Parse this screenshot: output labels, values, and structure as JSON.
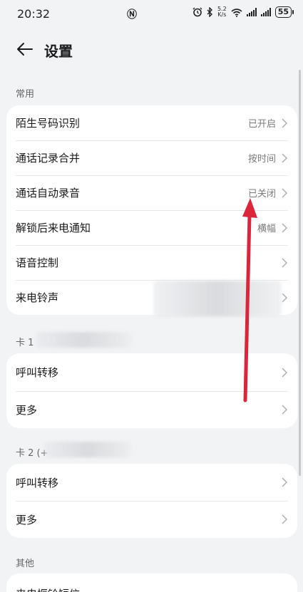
{
  "status_bar": {
    "time": "20:32",
    "net_speed_top": "5.2",
    "net_speed_bottom": "K/s",
    "battery": "55"
  },
  "header": {
    "title": "设置"
  },
  "sections": [
    {
      "label": "常用",
      "rows": [
        {
          "label": "陌生号码识别",
          "value": "已开启"
        },
        {
          "label": "通话记录合并",
          "value": "按时间"
        },
        {
          "label": "通话自动录音",
          "value": "已关闭"
        },
        {
          "label": "解锁后来电通知",
          "value": "横幅"
        },
        {
          "label": "语音控制",
          "value": ""
        },
        {
          "label": "来电铃声",
          "value": ""
        }
      ]
    },
    {
      "label": "卡 1",
      "rows": [
        {
          "label": "呼叫转移",
          "value": ""
        },
        {
          "label": "更多",
          "value": ""
        }
      ]
    },
    {
      "label": "卡 2 (+",
      "rows": [
        {
          "label": "呼叫转移",
          "value": ""
        },
        {
          "label": "更多",
          "value": ""
        }
      ]
    },
    {
      "label": "其他",
      "rows": [
        {
          "label": "来电振铃短信",
          "value": ""
        }
      ]
    }
  ],
  "colors": {
    "background": "#f1f3f5",
    "card": "#ffffff",
    "annotation_arrow": "#d9263b"
  }
}
